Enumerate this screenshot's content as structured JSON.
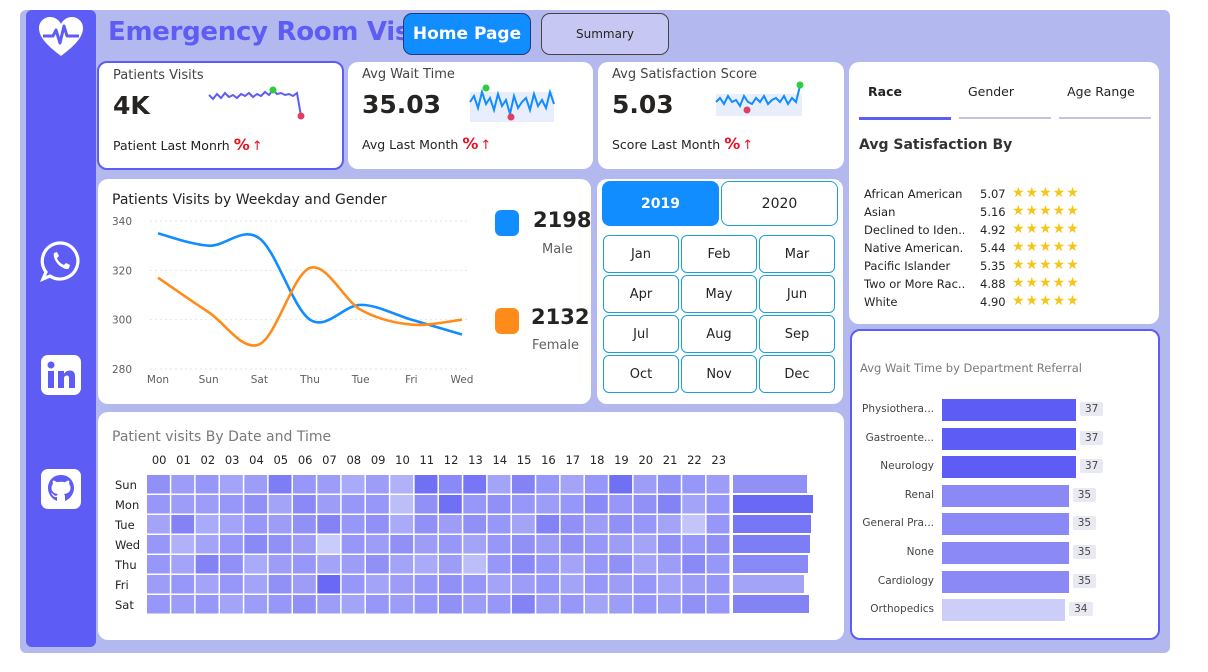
{
  "header": {
    "title": "Emergency Room Visits",
    "home_label": "Home Page",
    "summary_label": "Summary"
  },
  "sidebar": {
    "icons": [
      "heart-pulse-icon",
      "whatsapp-icon",
      "linkedin-icon",
      "github-icon"
    ]
  },
  "kpis": [
    {
      "label": "Patients Visits",
      "value": "4K",
      "foot": "Patient Last Monrh",
      "pct": "%",
      "arrow": "↑"
    },
    {
      "label": "Avg Wait Time",
      "value": "35.03",
      "foot": "Avg Last Month",
      "pct": "%",
      "arrow": "↑"
    },
    {
      "label": "Avg Satisfaction Score",
      "value": "5.03",
      "foot": "Score Last Month",
      "pct": "%",
      "arrow": "↑"
    }
  ],
  "line_chart": {
    "title": "Patients Visits by Weekday and Gender",
    "legend": {
      "male_value": "2198",
      "male_label": "Male",
      "female_value": "2132",
      "female_label": "Female"
    }
  },
  "chart_data": [
    {
      "type": "line",
      "title": "Patients Visits by Weekday and Gender",
      "categories": [
        "Mon",
        "Sun",
        "Sat",
        "Thu",
        "Tue",
        "Fri",
        "Wed"
      ],
      "series": [
        {
          "name": "Male",
          "color": "#118dff",
          "values": [
            335,
            330,
            333,
            300,
            306,
            300,
            294
          ]
        },
        {
          "name": "Female",
          "color": "#ff8c1a",
          "values": [
            317,
            303,
            290,
            321,
            304,
            298,
            300
          ]
        }
      ],
      "yticks": [
        280,
        300,
        320,
        340
      ],
      "ylim": [
        280,
        340
      ],
      "grid": true
    },
    {
      "type": "heatmap",
      "title": "Patient visits By Date and Time",
      "x": [
        "00",
        "01",
        "02",
        "03",
        "04",
        "05",
        "06",
        "07",
        "08",
        "09",
        "10",
        "11",
        "12",
        "13",
        "14",
        "15",
        "16",
        "17",
        "18",
        "19",
        "20",
        "21",
        "22",
        "23"
      ],
      "y": [
        "Sun",
        "Mon",
        "Tue",
        "Wed",
        "Thu",
        "Fri",
        "Sat"
      ],
      "values": [
        [
          0.6,
          0.5,
          0.55,
          0.45,
          0.5,
          0.75,
          0.55,
          0.5,
          0.4,
          0.5,
          0.35,
          0.85,
          0.65,
          0.8,
          0.45,
          0.7,
          0.55,
          0.45,
          0.55,
          0.85,
          0.5,
          0.6,
          0.55,
          0.5
        ],
        [
          0.55,
          0.5,
          0.5,
          0.55,
          0.6,
          0.45,
          0.65,
          0.5,
          0.55,
          0.55,
          0.25,
          0.6,
          0.85,
          0.55,
          0.6,
          0.55,
          0.5,
          0.55,
          0.65,
          0.55,
          0.6,
          0.7,
          0.45,
          0.55
        ],
        [
          0.45,
          0.7,
          0.4,
          0.45,
          0.55,
          0.5,
          0.6,
          0.7,
          0.55,
          0.6,
          0.4,
          0.6,
          0.5,
          0.6,
          0.55,
          0.45,
          0.7,
          0.6,
          0.5,
          0.6,
          0.55,
          0.45,
          0.2,
          0.55
        ],
        [
          0.55,
          0.35,
          0.45,
          0.55,
          0.65,
          0.6,
          0.5,
          0.15,
          0.55,
          0.5,
          0.6,
          0.5,
          0.55,
          0.45,
          0.55,
          0.6,
          0.5,
          0.6,
          0.55,
          0.5,
          0.45,
          0.6,
          0.55,
          0.6
        ],
        [
          0.55,
          0.45,
          0.7,
          0.6,
          0.4,
          0.5,
          0.55,
          0.45,
          0.5,
          0.6,
          0.45,
          0.4,
          0.5,
          0.25,
          0.55,
          0.65,
          0.55,
          0.45,
          0.55,
          0.6,
          0.45,
          0.5,
          0.65,
          0.55
        ],
        [
          0.5,
          0.55,
          0.45,
          0.55,
          0.45,
          0.6,
          0.5,
          0.9,
          0.55,
          0.45,
          0.5,
          0.55,
          0.6,
          0.55,
          0.45,
          0.5,
          0.55,
          0.45,
          0.55,
          0.5,
          0.55,
          0.45,
          0.5,
          0.55
        ],
        [
          0.55,
          0.5,
          0.55,
          0.45,
          0.5,
          0.55,
          0.6,
          0.5,
          0.45,
          0.55,
          0.5,
          0.55,
          0.6,
          0.5,
          0.55,
          0.7,
          0.5,
          0.55,
          0.45,
          0.5,
          0.55,
          0.5,
          0.6,
          0.55
        ]
      ],
      "row_totals": [
        0.6,
        0.9,
        0.8,
        0.75,
        0.65,
        0.45,
        0.7
      ]
    },
    {
      "type": "bar",
      "title": "Avg Wait Time by Department Referral",
      "categories": [
        "Physiothera...",
        "Gastroente...",
        "Neurology",
        "Renal",
        "General Pra...",
        "None",
        "Cardiology",
        "Orthopedics"
      ],
      "values": [
        37,
        37,
        37,
        35,
        35,
        35,
        35,
        34
      ],
      "labels": [
        "37",
        "37",
        "37",
        "35",
        "35",
        "35",
        "35",
        "34"
      ],
      "xlim": [
        0,
        37
      ]
    }
  ],
  "years": [
    "2019",
    "2020"
  ],
  "months": [
    "Jan",
    "Feb",
    "Mar",
    "Apr",
    "May",
    "Jun",
    "Jul",
    "Aug",
    "Sep",
    "Oct",
    "Nov",
    "Dec"
  ],
  "race_panel": {
    "tabs": [
      "Race",
      "Gender",
      "Age Range"
    ],
    "title": "Avg Satisfaction By",
    "rows": [
      {
        "name": "African American",
        "value": "5.07"
      },
      {
        "name": "Asian",
        "value": "5.16"
      },
      {
        "name": "Declined to Iden...",
        "value": "4.92"
      },
      {
        "name": "Native American...",
        "value": "5.44"
      },
      {
        "name": "Pacific Islander",
        "value": "5.35"
      },
      {
        "name": "Two or More Rac...",
        "value": "4.88"
      },
      {
        "name": "White",
        "value": "4.90"
      }
    ],
    "stars": "★★★★★"
  },
  "heatmap_title": "Patient visits By Date and Time",
  "wait_title": "Avg Wait Time by Department Referral",
  "colors": {
    "accent": "#5d5cf4",
    "blue": "#118dff",
    "orange": "#ff8c1a",
    "red": "#e81123"
  }
}
